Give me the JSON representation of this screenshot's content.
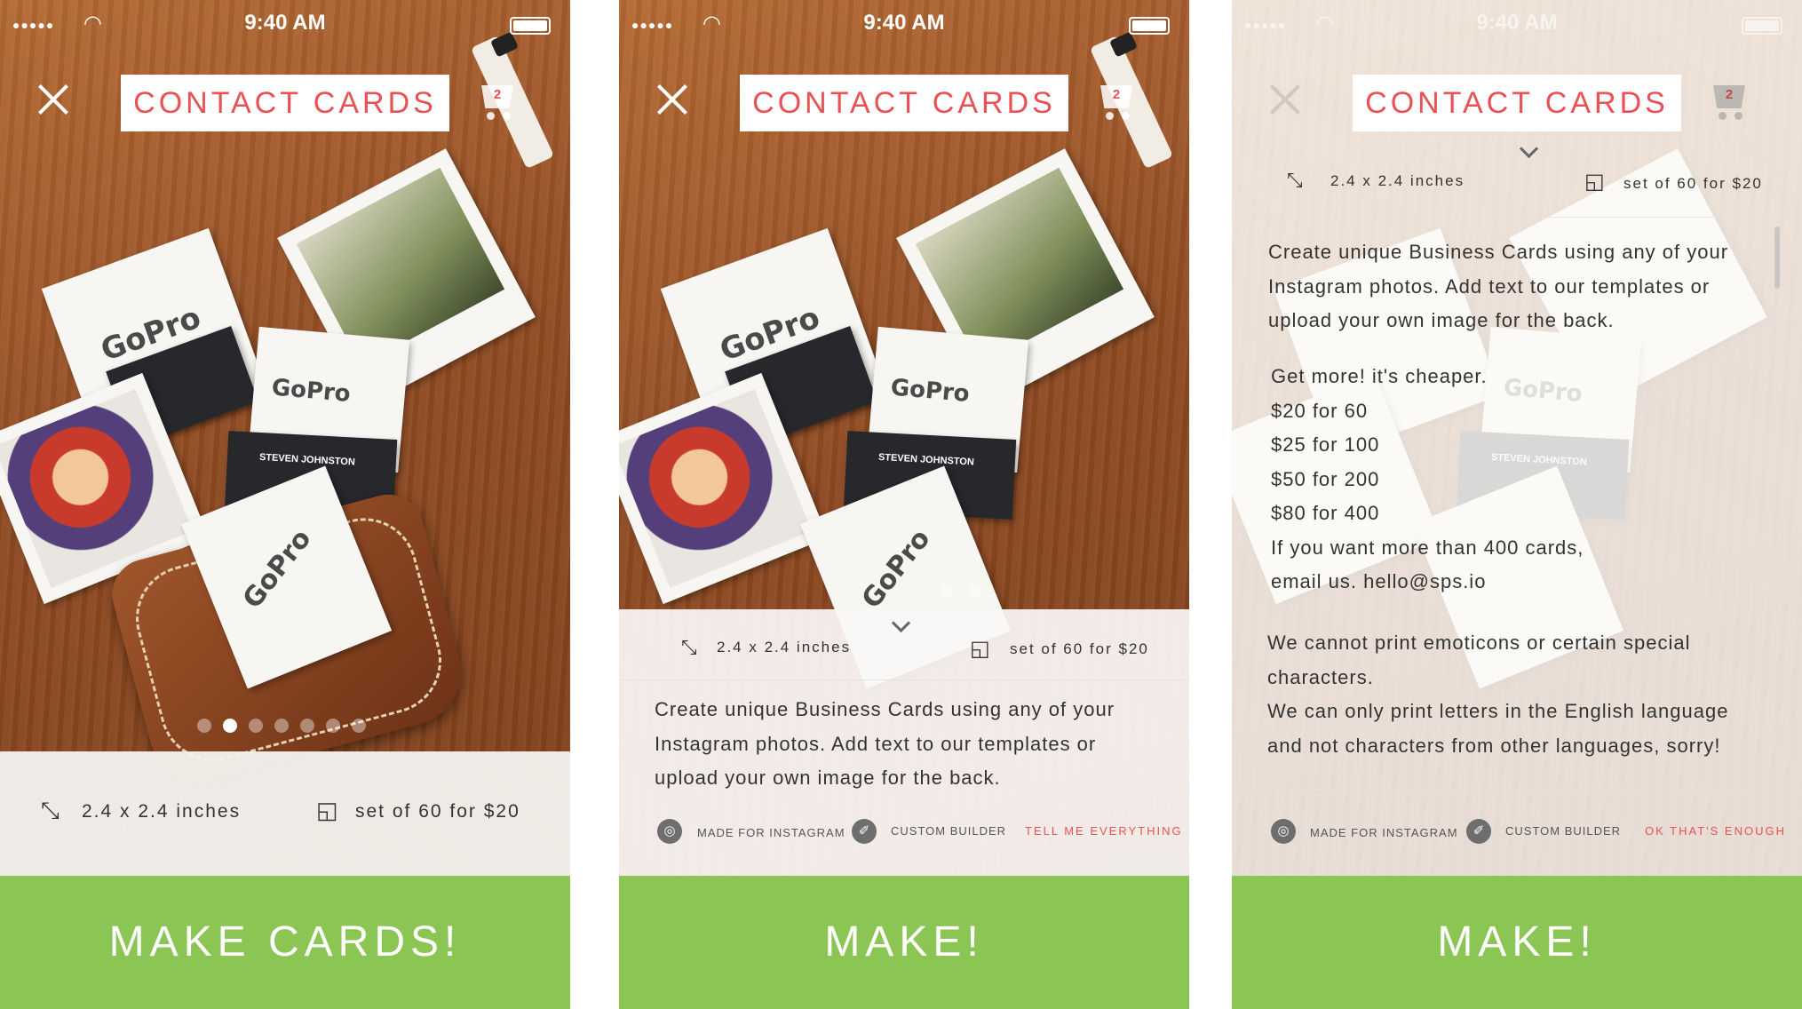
{
  "status_bar": {
    "signal": "●●●●●",
    "wifi": "◠",
    "time": "9:40 AM"
  },
  "header": {
    "title": "CONTACT CARDS",
    "cart_count": "2"
  },
  "specs": {
    "size": "2.4 x 2.4 inches",
    "price": "set of 60 for $20"
  },
  "features": {
    "instagram": "MADE FOR INSTAGRAM",
    "builder": "CUSTOM BUILDER",
    "expand_link": "TELL ME EVERYTHING",
    "collapse_link": "OK THAT'S ENOUGH"
  },
  "description": [
    "Create unique Business Cards using any of your",
    "Instagram photos.  Add text to our templates or",
    "upload your own image for the back."
  ],
  "pricing": [
    "Get more! it's cheaper.",
    "$20 for 60",
    "$25 for 100",
    "$50 for 200",
    "$80 for 400",
    "If you want more than 400 cards,",
    "email us. hello@sps.io"
  ],
  "notes": [
    "We cannot print emoticons or certain special",
    "characters.",
    "We can only print letters in the English language",
    "and not characters from other languages, sorry!"
  ],
  "card_texts": {
    "brand": "GoPro",
    "name": "STEVEN JOHNSTON"
  },
  "carousel": {
    "total": 7,
    "active": 2
  },
  "cta": {
    "make_cards": "MAKE CARDS!",
    "make": "MAKE!"
  },
  "icons": {
    "close": "close-icon",
    "cart": "cart-icon",
    "size": "resize-arrow-icon",
    "set": "card-stack-icon",
    "instagram": "instagram-icon",
    "builder": "hammer-icon",
    "chevron": "chevron-down-icon"
  },
  "colors": {
    "accent": "#ea5154",
    "cta": "#8bc655"
  }
}
